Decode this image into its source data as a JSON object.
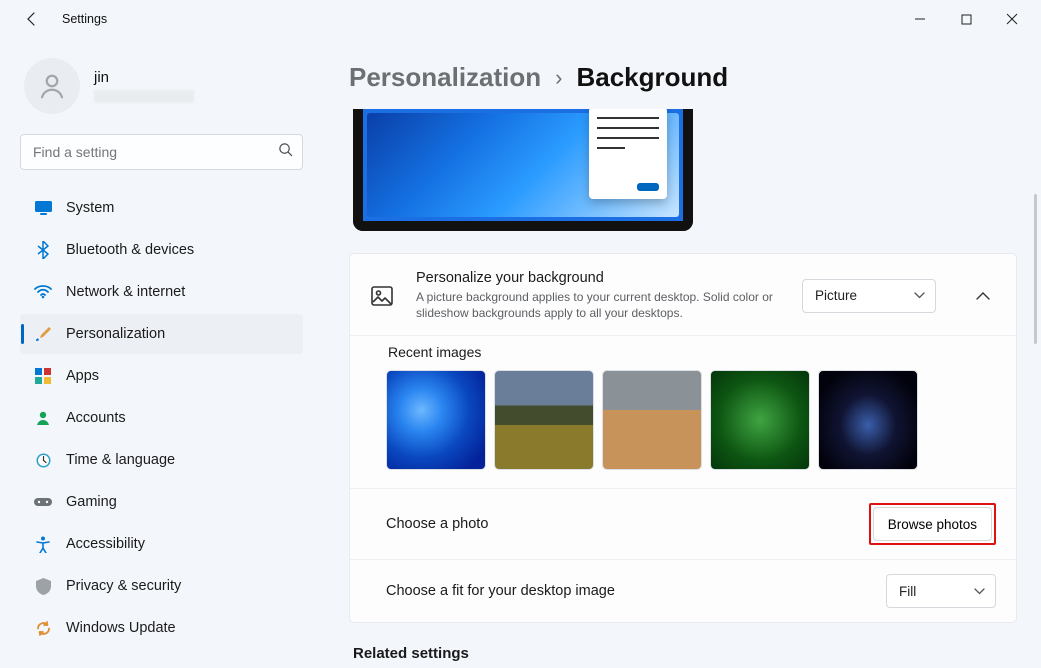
{
  "app": {
    "name": "Settings"
  },
  "user": {
    "name": "jin"
  },
  "search": {
    "placeholder": "Find a setting"
  },
  "nav": {
    "items": [
      {
        "label": "System"
      },
      {
        "label": "Bluetooth & devices"
      },
      {
        "label": "Network & internet"
      },
      {
        "label": "Personalization"
      },
      {
        "label": "Apps"
      },
      {
        "label": "Accounts"
      },
      {
        "label": "Time & language"
      },
      {
        "label": "Gaming"
      },
      {
        "label": "Accessibility"
      },
      {
        "label": "Privacy & security"
      },
      {
        "label": "Windows Update"
      }
    ],
    "selected_index": 3
  },
  "breadcrumb": {
    "parent": "Personalization",
    "current": "Background"
  },
  "personalize": {
    "title": "Personalize your background",
    "desc": "A picture background applies to your current desktop. Solid color or slideshow backgrounds apply to all your desktops.",
    "select_value": "Picture"
  },
  "recent": {
    "label": "Recent images"
  },
  "choose_photo": {
    "label": "Choose a photo",
    "button": "Browse photos"
  },
  "choose_fit": {
    "label": "Choose a fit for your desktop image",
    "select_value": "Fill"
  },
  "related": {
    "title": "Related settings"
  }
}
